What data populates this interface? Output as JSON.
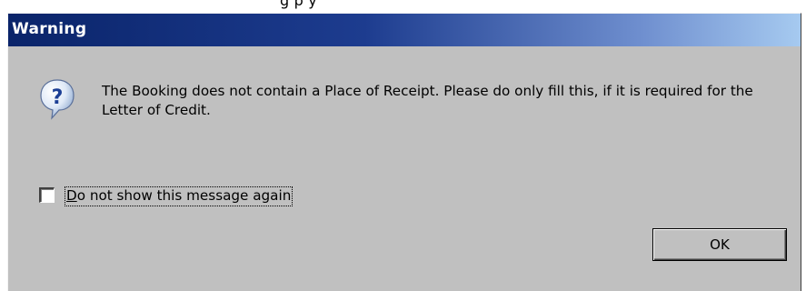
{
  "background": {
    "partial_text": "g        p       y"
  },
  "dialog": {
    "title": "Warning",
    "icon": "question-icon",
    "message": "The Booking does not contain a Place of Receipt. Please do only fill this, if it is required for the Letter of Credit.",
    "checkbox": {
      "label_first": "D",
      "label_rest": "o not show this message again",
      "checked": false
    },
    "ok_label": "OK"
  },
  "colors": {
    "dialog_bg": "#c0c0c0",
    "title_start": "#0a246a",
    "title_end": "#a6caf0",
    "title_text": "#ffffff"
  }
}
